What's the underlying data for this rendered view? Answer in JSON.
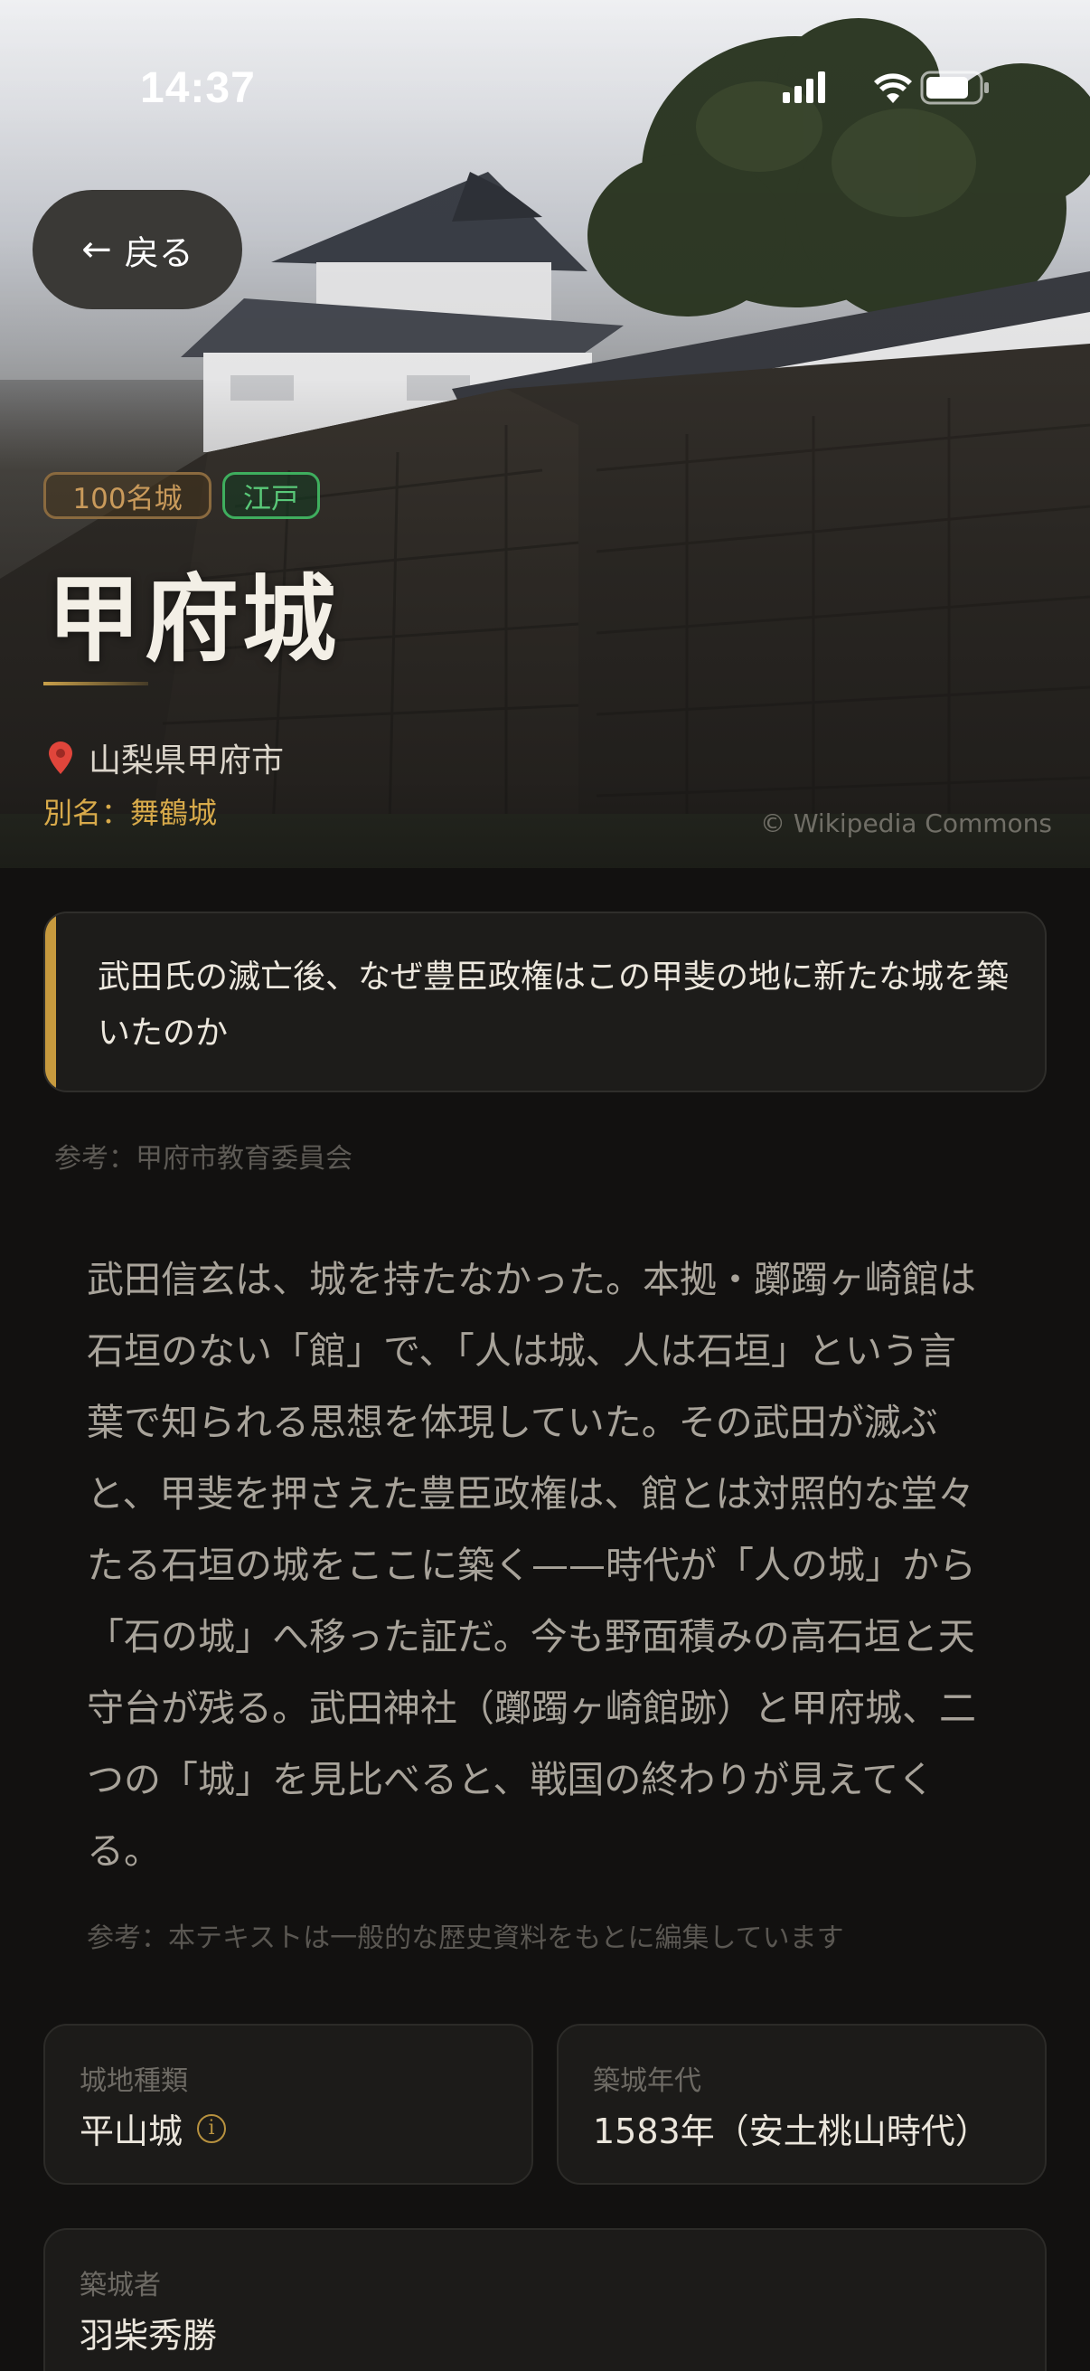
{
  "status_bar": {
    "time": "14:37"
  },
  "back_button": {
    "label": "戻る",
    "icon": "arrow-left-icon"
  },
  "hero": {
    "tags": [
      {
        "label": "100名城",
        "color": "#c99a5b"
      },
      {
        "label": "江戸",
        "color": "#59c878"
      }
    ],
    "castle_name": "甲府城",
    "location": "山梨県甲府市",
    "alias": "別名：舞鶴城",
    "photo_credit": "© Wikipedia Commons"
  },
  "question": {
    "text": "武田氏の滅亡後、なぜ豊臣政権はこの甲斐の地に新たな城を築いたのか",
    "accent_color": "#c79a3e"
  },
  "reference_top": "参考：甲府市教育委員会",
  "body": {
    "text": "武田信玄は、城を持たなかった。本拠・躑躅ヶ崎館は石垣のない「館」で、「人は城、人は石垣」という言葉で知られる思想を体現していた。その武田が滅ぶと、甲斐を押さえた豊臣政権は、館とは対照的な堂々たる石垣の城をここに築く——時代が「人の城」から「石の城」へ移った証だ。今も野面積みの高石垣と天守台が残る。武田神社（躑躅ヶ崎館跡）と甲府城、二つの「城」を見比べると、戦国の終わりが見えてくる。",
    "reference": "参考：本テキストは一般的な歴史資料をもとに編集しています"
  },
  "info": {
    "castle_type": {
      "label": "城地種類",
      "value": "平山城",
      "icon": "info-icon"
    },
    "built_year": {
      "label": "築城年代",
      "value": "1583年（安土桃山時代）"
    },
    "builder": {
      "label": "築城者",
      "value": "羽柴秀勝"
    }
  }
}
